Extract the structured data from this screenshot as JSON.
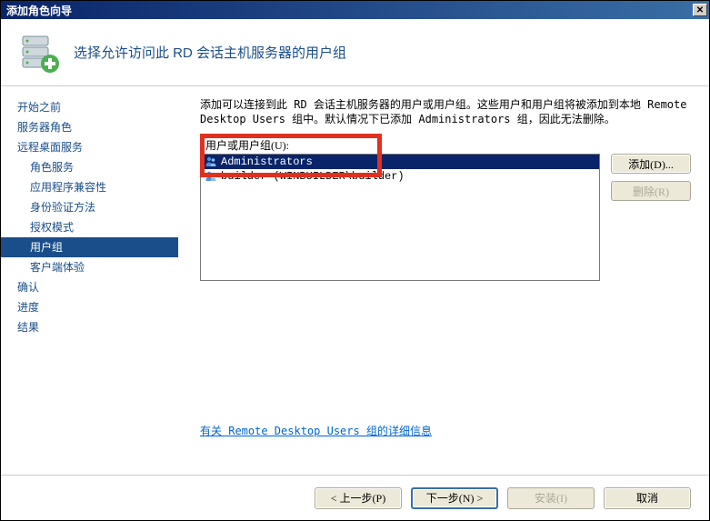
{
  "window": {
    "title": "添加角色向导"
  },
  "header": {
    "title": "选择允许访问此 RD 会话主机服务器的用户组"
  },
  "sidebar": {
    "items": [
      {
        "label": "开始之前",
        "sub": false,
        "selected": false
      },
      {
        "label": "服务器角色",
        "sub": false,
        "selected": false
      },
      {
        "label": "远程桌面服务",
        "sub": false,
        "selected": false
      },
      {
        "label": "角色服务",
        "sub": true,
        "selected": false
      },
      {
        "label": "应用程序兼容性",
        "sub": true,
        "selected": false
      },
      {
        "label": "身份验证方法",
        "sub": true,
        "selected": false
      },
      {
        "label": "授权模式",
        "sub": true,
        "selected": false
      },
      {
        "label": "用户组",
        "sub": true,
        "selected": true
      },
      {
        "label": "客户端体验",
        "sub": true,
        "selected": false
      },
      {
        "label": "确认",
        "sub": false,
        "selected": false
      },
      {
        "label": "进度",
        "sub": false,
        "selected": false
      },
      {
        "label": "结果",
        "sub": false,
        "selected": false
      }
    ]
  },
  "main": {
    "description": "添加可以连接到此 RD 会话主机服务器的用户或用户组。这些用户和用户组将被添加到本地 Remote Desktop Users 组中。默认情况下已添加 Administrators 组，因此无法删除。",
    "list_label": "用户或用户组(U):",
    "list_items": [
      {
        "label": "Administrators",
        "selected": true
      },
      {
        "label": "builder (WINBUILDER\\builder)",
        "selected": false
      }
    ],
    "add_btn": "添加(D)...",
    "remove_btn": "删除(R)",
    "link_text": "有关 Remote Desktop Users 组的详细信息"
  },
  "footer": {
    "prev": "< 上一步(P)",
    "next": "下一步(N) >",
    "install": "安装(I)",
    "cancel": "取消"
  }
}
